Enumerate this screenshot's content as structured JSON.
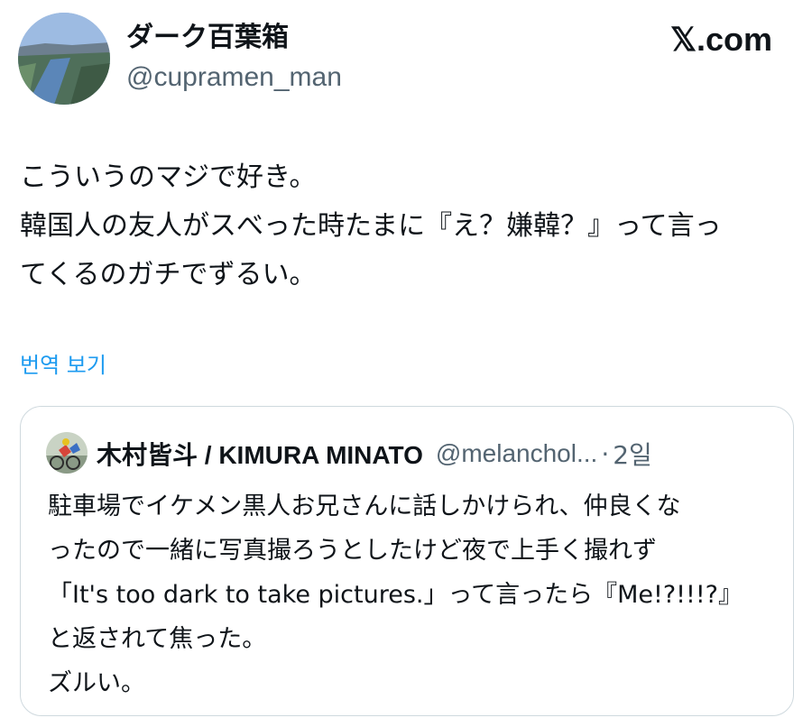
{
  "author": {
    "display_name": "ダーク百葉箱",
    "handle": "@cupramen_man"
  },
  "brand": "𝕏.com",
  "tweet": {
    "lines": [
      "こういうのマジで好き。",
      "韓国人の友人がスべった時たまに『え？嫌韓？』って言っ",
      "てくるのガチでずるい。"
    ],
    "translate_label": "번역 보기"
  },
  "quote": {
    "display_name": "木村皆斗 / KIMURA MINATO",
    "handle": "@melanchol...",
    "separator": "·",
    "age": "2일",
    "lines": [
      "駐車場でイケメン黒人お兄さんに話しかけられ、仲良くな",
      "ったので一緒に写真撮ろうとしたけど夜で上手く撮れず",
      "「It's too dark to take pictures.」って言ったら『Me!?!!!?』",
      "と返されて焦った。",
      "ズルい。"
    ]
  },
  "icons": {
    "author_avatar": "river-landscape-avatar",
    "quote_avatar": "cyclists-avatar"
  },
  "colors": {
    "link": "#1d9bf0",
    "secondary_text": "#536471",
    "card_border": "#cfd9de"
  }
}
